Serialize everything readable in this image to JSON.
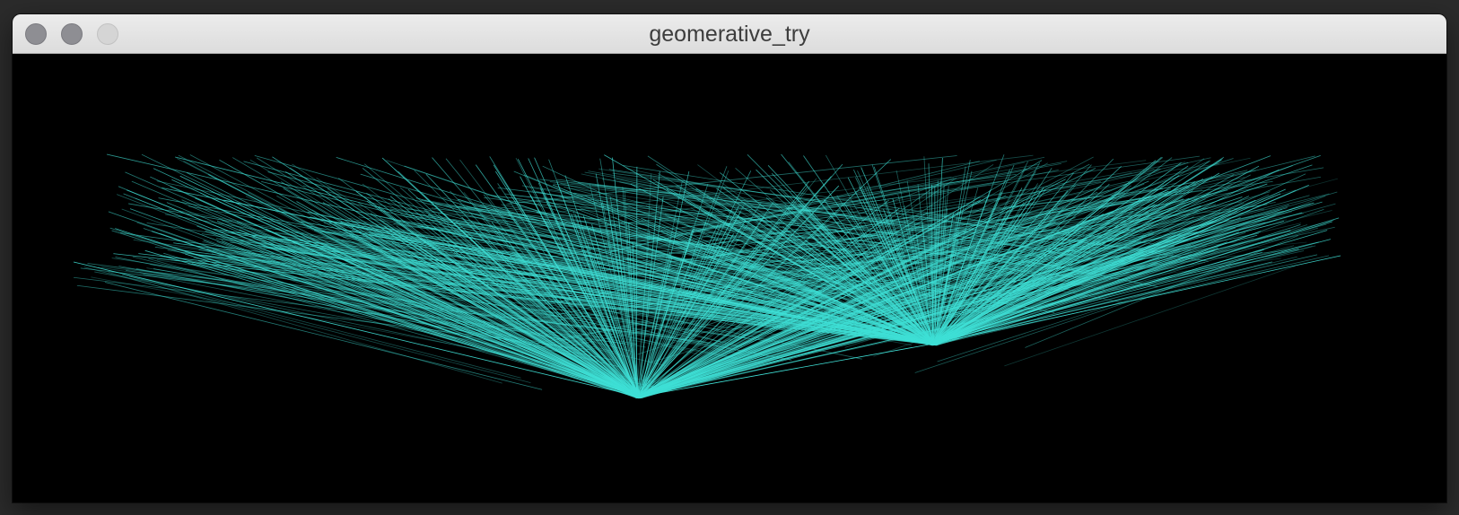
{
  "window": {
    "title": "geomerative_try"
  },
  "titlebar_buttons": [
    {
      "name": "close",
      "icon": "close-icon"
    },
    {
      "name": "minimize",
      "icon": "minimize-icon"
    },
    {
      "name": "zoom",
      "icon": "zoom-icon"
    }
  ],
  "canvas": {
    "background": "#000000",
    "stroke_color": "#3fe0d6"
  }
}
